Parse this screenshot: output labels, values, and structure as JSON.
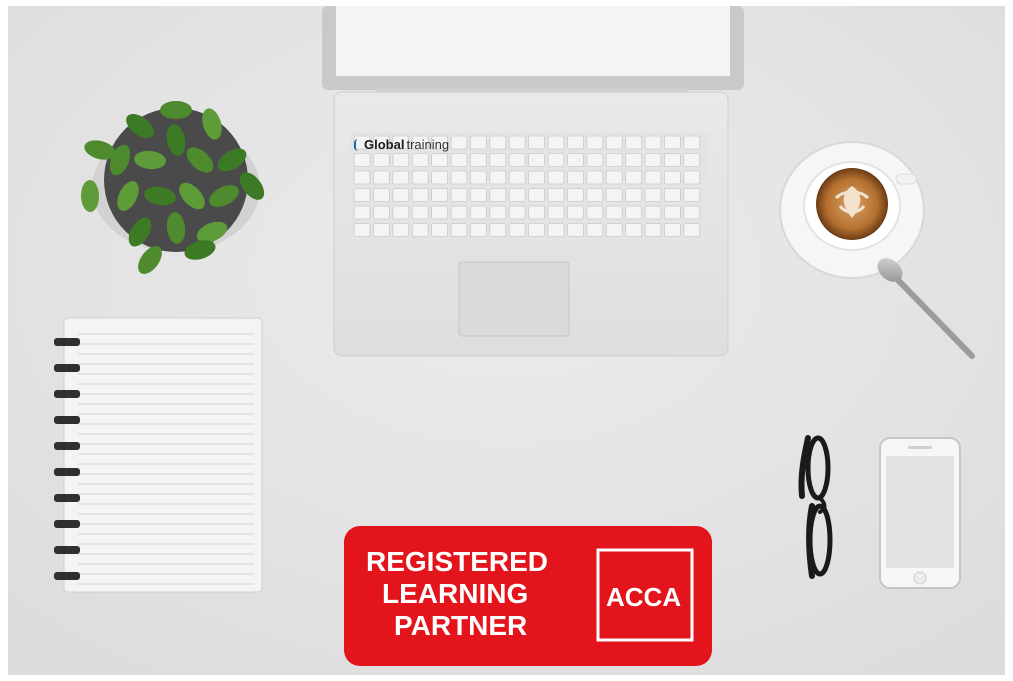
{
  "badge": {
    "lines": [
      "REGISTERED",
      "LEARNING",
      "PARTNER"
    ],
    "logo_text": "ACCA",
    "color": "#e3141c"
  },
  "laptop_logo": {
    "bold": "Global",
    "regular": "training"
  },
  "objects": {
    "plant": "potted-plant",
    "laptop": "laptop-keyboard",
    "coffee": "coffee-cup-latte-art",
    "spoon": "spoon",
    "notebook": "spiral-notebook",
    "glasses": "eyeglasses",
    "phone": "smartphone"
  }
}
